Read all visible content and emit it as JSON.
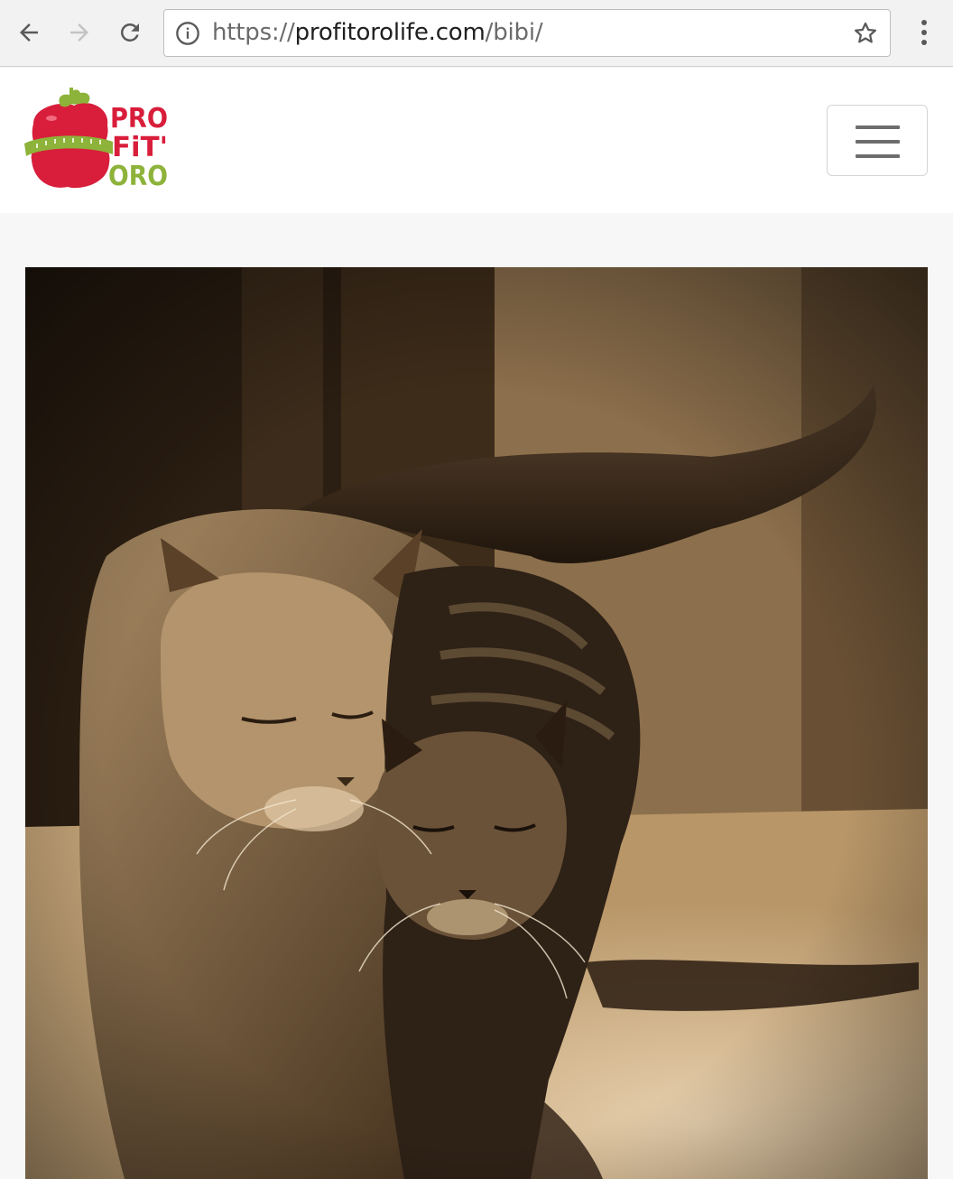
{
  "browser": {
    "url_scheme": "https://",
    "url_host": "profitorolife.com",
    "url_path": "/bibi/",
    "icons": [
      "back-arrow-icon",
      "forward-arrow-icon",
      "reload-icon",
      "info-icon",
      "star-icon",
      "more-vert-icon"
    ]
  },
  "header": {
    "logo_lines": [
      "PRO",
      "FiT'",
      "ORO"
    ],
    "logo_colors": {
      "red": "#d81e3b",
      "green": "#8db33a"
    },
    "menu_icon": "hamburger-icon"
  },
  "content": {
    "image_subject": "two cats"
  }
}
